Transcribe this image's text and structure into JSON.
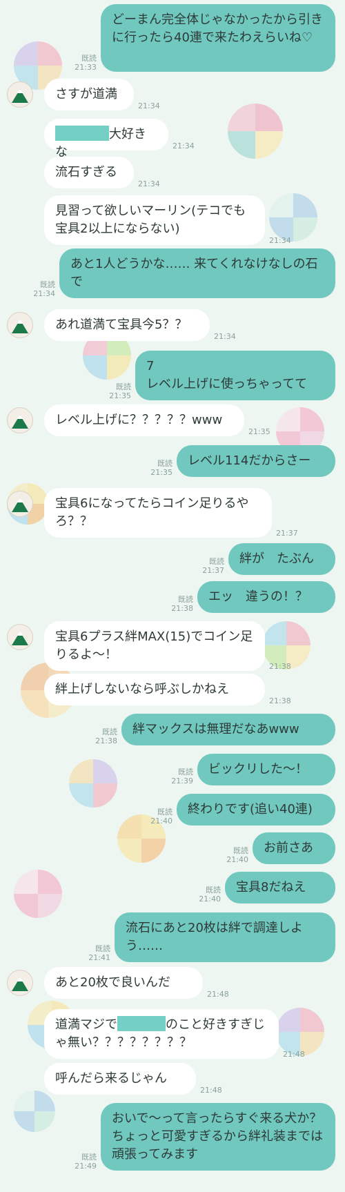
{
  "colors": {
    "outgoing": "#71c8be",
    "incoming": "#ffffff",
    "background": "#eef6f2",
    "redaction": "#74cfc4"
  },
  "icons": {
    "avatar": "mountain-avatar-icon"
  },
  "messages": [
    {
      "dir": "out",
      "text": "どーまん完全体じゃなかったから引きに行ったら40連で来たわえらいね♡",
      "read": "既読",
      "time": "21:33"
    },
    {
      "dir": "in",
      "text": "さすが道満",
      "time": "21:34",
      "avatar": true
    },
    {
      "dir": "in",
      "text": "大好きな",
      "redacted_prefix": true,
      "time": "21:34"
    },
    {
      "dir": "in",
      "text": "流石すぎる",
      "time": "21:34"
    },
    {
      "dir": "in",
      "text": "見習って欲しいマーリン(テコでも宝具2以上にならない)",
      "time": "21:34"
    },
    {
      "dir": "out",
      "text": "あと1人どうかな…… 来てくれなけなしの石で",
      "read": "既読",
      "time": "21:34"
    },
    {
      "dir": "in",
      "text": "あれ道満て宝具今5？？",
      "time": "21:34",
      "avatar": true
    },
    {
      "dir": "out",
      "text": "7\nレベル上げに使っちゃってて",
      "read": "既読",
      "time": "21:35"
    },
    {
      "dir": "in",
      "text": "レベル上げに？？？？？www",
      "time": "21:35",
      "avatar": true
    },
    {
      "dir": "out",
      "text": "レベル114だからさー",
      "read": "既読",
      "time": "21:35"
    },
    {
      "dir": "in",
      "text": "宝具6になってたらコイン足りるやろ？？",
      "time": "21:37",
      "avatar": true
    },
    {
      "dir": "out",
      "text": "絆が　たぶん",
      "read": "既読",
      "time": "21:37"
    },
    {
      "dir": "out",
      "text": "エッ　違うの！？",
      "read": "既読",
      "time": "21:38"
    },
    {
      "dir": "in",
      "text": "宝具6プラス絆MAX(15)でコイン足りるよ〜！",
      "time": "21:38",
      "avatar": true
    },
    {
      "dir": "in",
      "text": "絆上げしないなら呼ぶしかねえ",
      "time": "21:38"
    },
    {
      "dir": "out",
      "text": "絆マックスは無理だなあwww",
      "read": "既読",
      "time": "21:38"
    },
    {
      "dir": "out",
      "text": "ビックリした〜！",
      "read": "既読",
      "time": "21:39"
    },
    {
      "dir": "out",
      "text": "終わりです(追い40連)",
      "read": "既読",
      "time": "21:40"
    },
    {
      "dir": "out",
      "text": "お前さあ",
      "read": "既読",
      "time": "21:40"
    },
    {
      "dir": "out",
      "text": "宝具8だねえ",
      "read": "既読",
      "time": "21:40"
    },
    {
      "dir": "out",
      "text": "流石にあと20枚は絆で調達しよう……",
      "read": "既読",
      "time": "21:41"
    },
    {
      "dir": "in",
      "text": "あと20枚で良いんだ",
      "time": "21:48",
      "avatar": true
    },
    {
      "dir": "in",
      "text": "道満マジで",
      "redacted_middle": true,
      "text_after": "のこと好きすぎじゃ無い？？？？？？？？",
      "time": "21:48"
    },
    {
      "dir": "in",
      "text": "呼んだら来るじゃん",
      "time": "21:48"
    },
    {
      "dir": "out",
      "text": "おいで〜って言ったらすぐ来る犬か？\nちょっと可愛すぎるから絆礼装までは頑張ってみます",
      "read": "既読",
      "time": "21:49"
    }
  ]
}
